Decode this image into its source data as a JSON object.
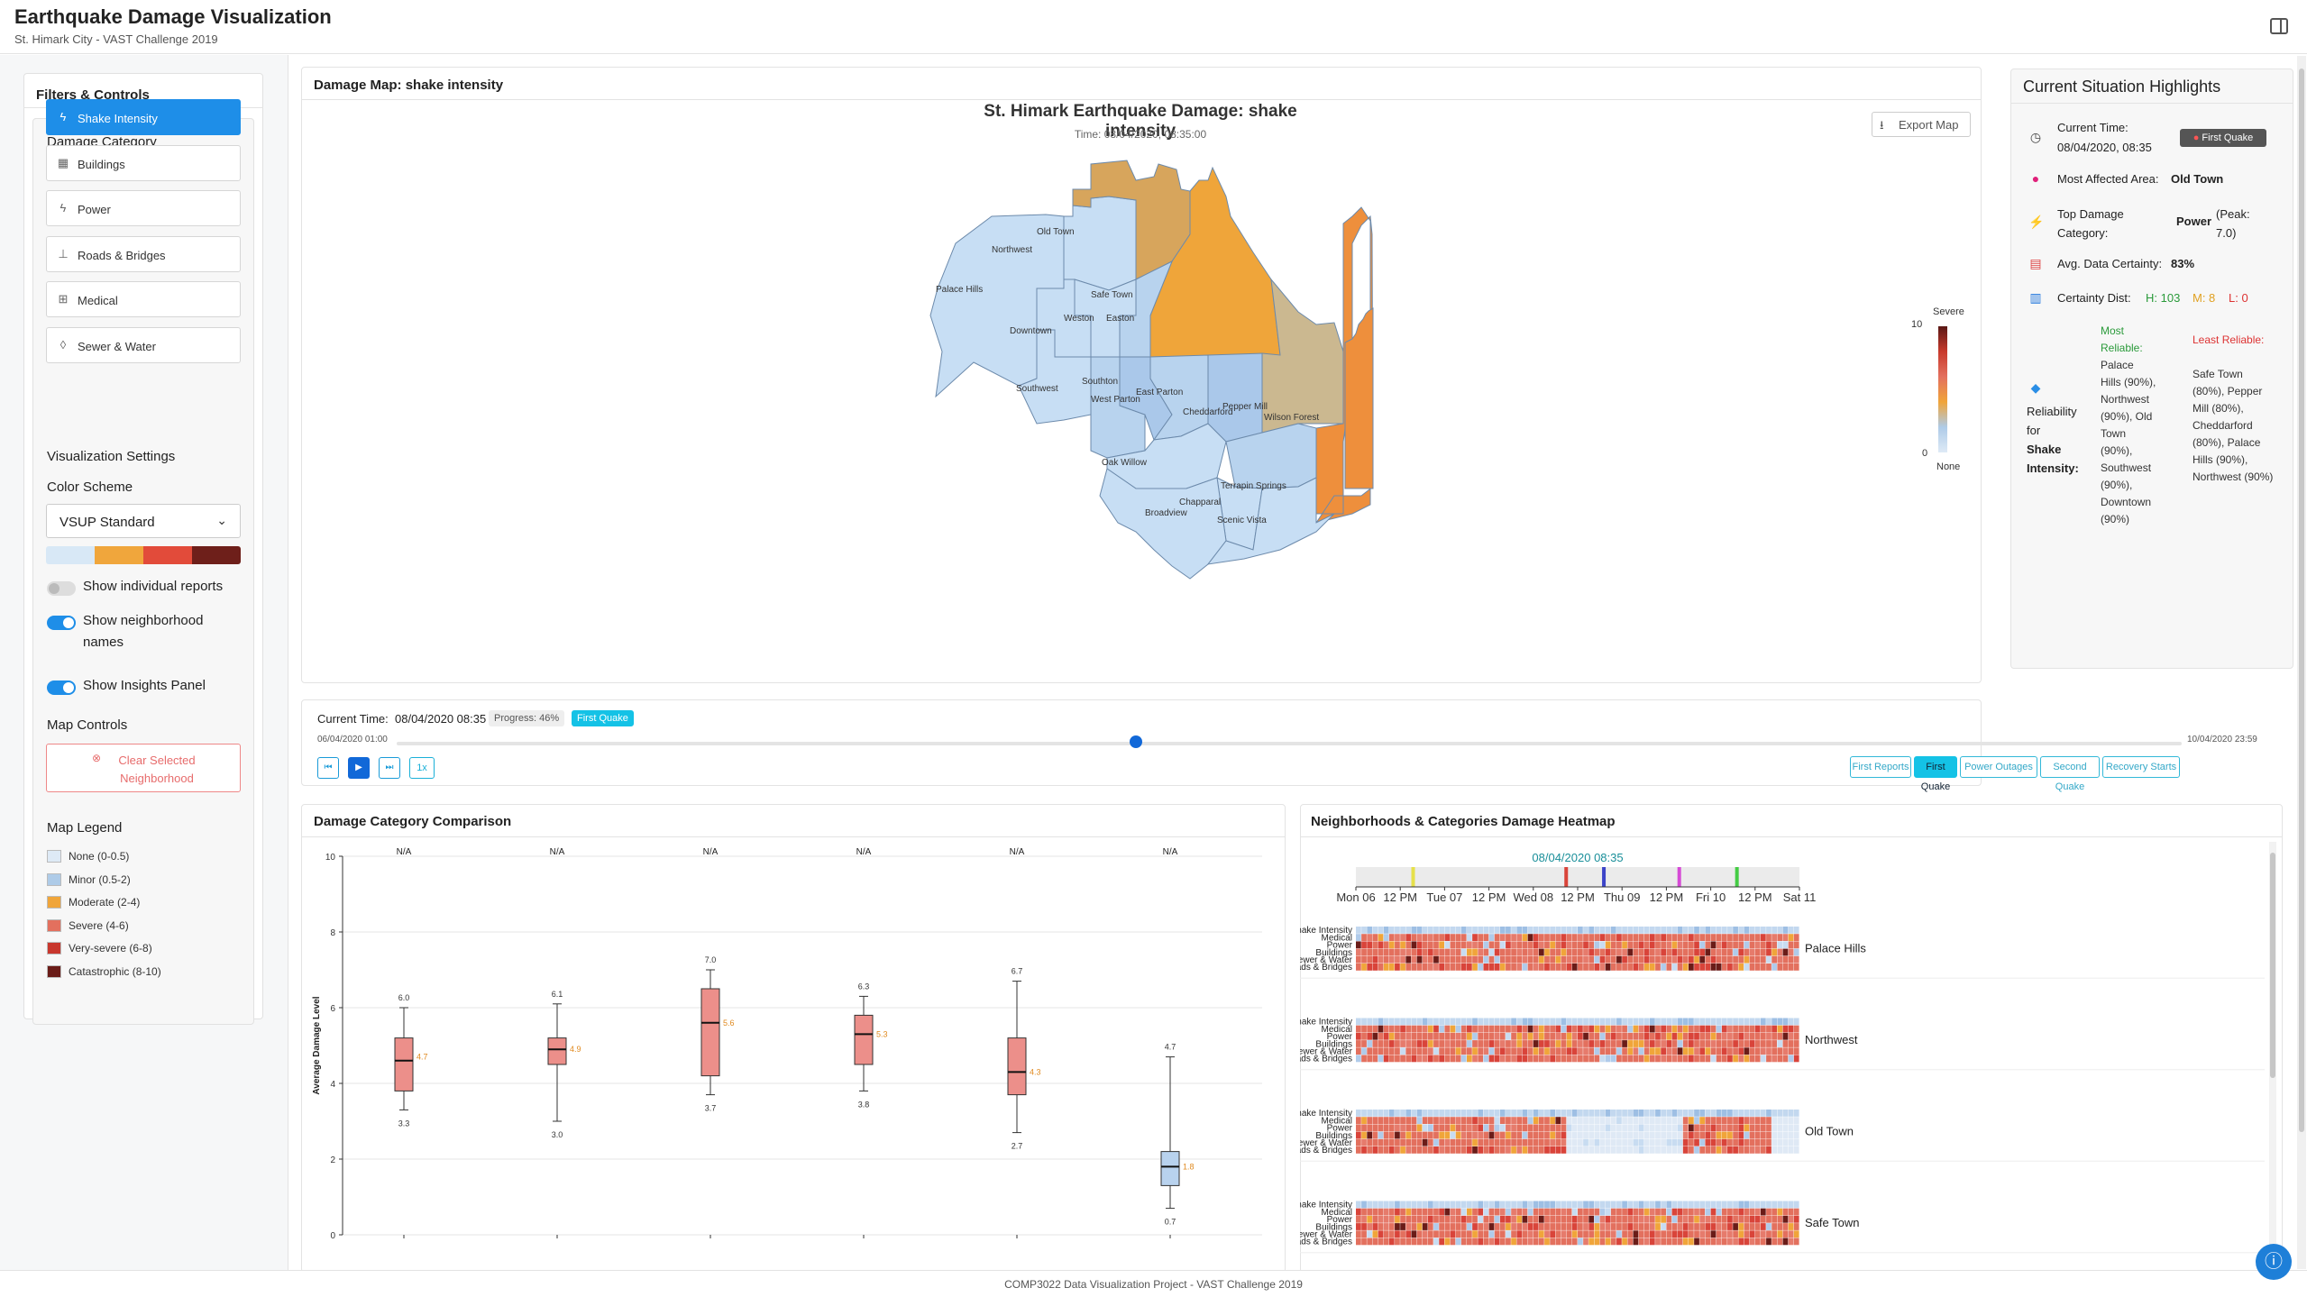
{
  "header": {
    "title": "Earthquake Damage Visualization",
    "subtitle": "St. Himark City - VAST Challenge 2019"
  },
  "sidebar": {
    "title": "Filters & Controls",
    "damage_category_label": "Damage Category",
    "categories": [
      {
        "label": "Shake Intensity",
        "icon": "lightning-icon",
        "active": true
      },
      {
        "label": "Buildings",
        "icon": "building-icon",
        "active": false
      },
      {
        "label": "Power",
        "icon": "lightning-icon",
        "active": false
      },
      {
        "label": "Roads & Bridges",
        "icon": "signpost-icon",
        "active": false
      },
      {
        "label": "Medical",
        "icon": "hospital-icon",
        "active": false
      },
      {
        "label": "Sewer & Water",
        "icon": "droplet-icon",
        "active": false
      }
    ],
    "viz_settings_label": "Visualization Settings",
    "color_scheme_label": "Color Scheme",
    "color_scheme_value": "VSUP Standard",
    "scheme_colors": [
      "#d8e8f6",
      "#f0a63c",
      "#e24b3a",
      "#6e1f1a"
    ],
    "toggles": [
      {
        "label": "Show individual reports",
        "on": false
      },
      {
        "label": "Show neighborhood names",
        "on": true
      },
      {
        "label": "Show Insights Panel",
        "on": true
      }
    ],
    "map_controls_label": "Map Controls",
    "clear_button": "Clear Selected Neighborhood",
    "legend_label": "Map Legend",
    "legend": [
      {
        "label": "None (0-0.5)",
        "color": "#deeaf6"
      },
      {
        "label": "Minor (0.5-2)",
        "color": "#aecbe8"
      },
      {
        "label": "Moderate (2-4)",
        "color": "#f0a53a"
      },
      {
        "label": "Severe (4-6)",
        "color": "#e3705e"
      },
      {
        "label": "Very-severe (6-8)",
        "color": "#c8372d"
      },
      {
        "label": "Catastrophic (8-10)",
        "color": "#6a1c18"
      }
    ]
  },
  "map": {
    "panel_title": "Damage Map: shake intensity",
    "title": "St. Himark Earthquake Damage: shake intensity",
    "time": "Time: 08/04/2020, 08:35:00",
    "export_label": "Export Map",
    "scale_top": "Severe",
    "scale_max": "10",
    "scale_min": "0",
    "scale_bottom": "None",
    "neighborhoods": [
      "Palace Hills",
      "Northwest",
      "Old Town",
      "Safe Town",
      "Weston",
      "Easton",
      "Downtown",
      "Southton",
      "Southwest",
      "West Parton",
      "East Parton",
      "Cheddarford",
      "Pepper Mill",
      "Wilson Forest",
      "Oak Willow",
      "Terrapin Springs",
      "Chapparal",
      "Broadview",
      "Scenic Vista"
    ]
  },
  "highlights": {
    "title": "Current Situation Highlights",
    "current_time_label": "Current Time:",
    "current_time_value": "08/04/2020, 08:35",
    "first_quake_badge": "First Quake",
    "most_affected_label": "Most Affected Area:",
    "most_affected_value": "Old Town",
    "top_damage_label": "Top Damage Category:",
    "top_damage_value": "Power",
    "top_damage_peak": "(Peak: 7.0)",
    "avg_certainty_label": "Avg. Data Certainty:",
    "avg_certainty_value": "83%",
    "certainty_dist_label": "Certainty Dist:",
    "cert_h": "H: 103",
    "cert_m": "M: 8",
    "cert_l": "L: 0",
    "reliability_label_1": "Reliability for",
    "reliability_label_2": "Shake Intensity:",
    "most_reliable_head": "Most Reliable:",
    "most_reliable_text": "Palace Hills (90%), Northwest (90%), Old Town (90%), Southwest (90%), Downtown (90%)",
    "least_reliable_head": "Least Reliable:",
    "least_reliable_text": "Safe Town (80%), Pepper Mill (80%), Cheddarford (80%), Palace Hills (90%), Northwest (90%)"
  },
  "timeline": {
    "current_time_label": "Current Time:",
    "current_time_value": "08/04/2020 08:35",
    "progress_label": "Progress: 46%",
    "progress": 0.46,
    "event_badge": "First Quake",
    "start_label": "06/04/2020 01:00",
    "end_label": "10/04/2020 23:59",
    "speed_label": "1x",
    "events": [
      {
        "label": "First Reports",
        "active": false
      },
      {
        "label": "First Quake",
        "active": true
      },
      {
        "label": "Power Outages",
        "active": false
      },
      {
        "label": "Second Quake",
        "active": false
      },
      {
        "label": "Recovery Starts",
        "active": false
      }
    ]
  },
  "boxplot": {
    "panel_title": "Damage Category Comparison",
    "ylabel": "Average Damage Level"
  },
  "heatmap": {
    "panel_title": "Neighborhoods & Categories Damage Heatmap",
    "current_time": "08/04/2020 08:35",
    "row_labels": [
      "Shake Intensity",
      "Medical",
      "Power",
      "Buildings",
      "Sewer & Water",
      "Roads & Bridges"
    ],
    "event_marker_colors": [
      "#e6e04a",
      "#d9443a",
      "#3c44c8",
      "#d64ad6",
      "#44cc44"
    ]
  },
  "footer": {
    "text": "COMP3022 Data Visualization Project - VAST Challenge 2019"
  },
  "chart_data": [
    {
      "type": "boxplot",
      "title": "",
      "ylabel": "Average Damage Level",
      "ylim": [
        0,
        10
      ],
      "yticks": [
        0,
        2,
        4,
        6,
        8,
        10
      ],
      "series": [
        {
          "top_label": "N/A",
          "min": 3.3,
          "q1": 3.8,
          "median": 4.6,
          "q3": 5.2,
          "max": 6.0,
          "mean": 4.7,
          "color": "#ec8f8a"
        },
        {
          "top_label": "N/A",
          "min": 3.0,
          "q1": 4.5,
          "median": 4.9,
          "q3": 5.2,
          "max": 6.1,
          "mean": 4.9,
          "color": "#ec8f8a"
        },
        {
          "top_label": "N/A",
          "min": 3.7,
          "q1": 4.2,
          "median": 5.6,
          "q3": 6.5,
          "max": 7.0,
          "mean": 5.6,
          "color": "#ec8f8a"
        },
        {
          "top_label": "N/A",
          "min": 3.8,
          "q1": 4.5,
          "median": 5.3,
          "q3": 5.8,
          "max": 6.3,
          "mean": 5.3,
          "color": "#ec8f8a"
        },
        {
          "top_label": "N/A",
          "min": 2.7,
          "q1": 3.7,
          "median": 4.3,
          "q3": 5.2,
          "max": 6.7,
          "mean": 4.3,
          "color": "#ec8f8a"
        },
        {
          "top_label": "N/A",
          "min": 0.7,
          "q1": 1.3,
          "median": 1.8,
          "q3": 2.2,
          "max": 4.7,
          "mean": 1.8,
          "color": "#b8d2ee"
        }
      ]
    },
    {
      "type": "heatmap",
      "x_ticks": [
        "Mon 06",
        "12 PM",
        "Tue 07",
        "12 PM",
        "Wed 08",
        "12 PM",
        "Thu 09",
        "12 PM",
        "Fri 10",
        "12 PM",
        "Sat 11"
      ],
      "neighborhoods": [
        "Palace Hills",
        "Northwest",
        "Old Town",
        "Safe Town"
      ],
      "rows": [
        "Shake Intensity",
        "Medical",
        "Power",
        "Buildings",
        "Sewer & Water",
        "Roads & Bridges"
      ]
    }
  ]
}
